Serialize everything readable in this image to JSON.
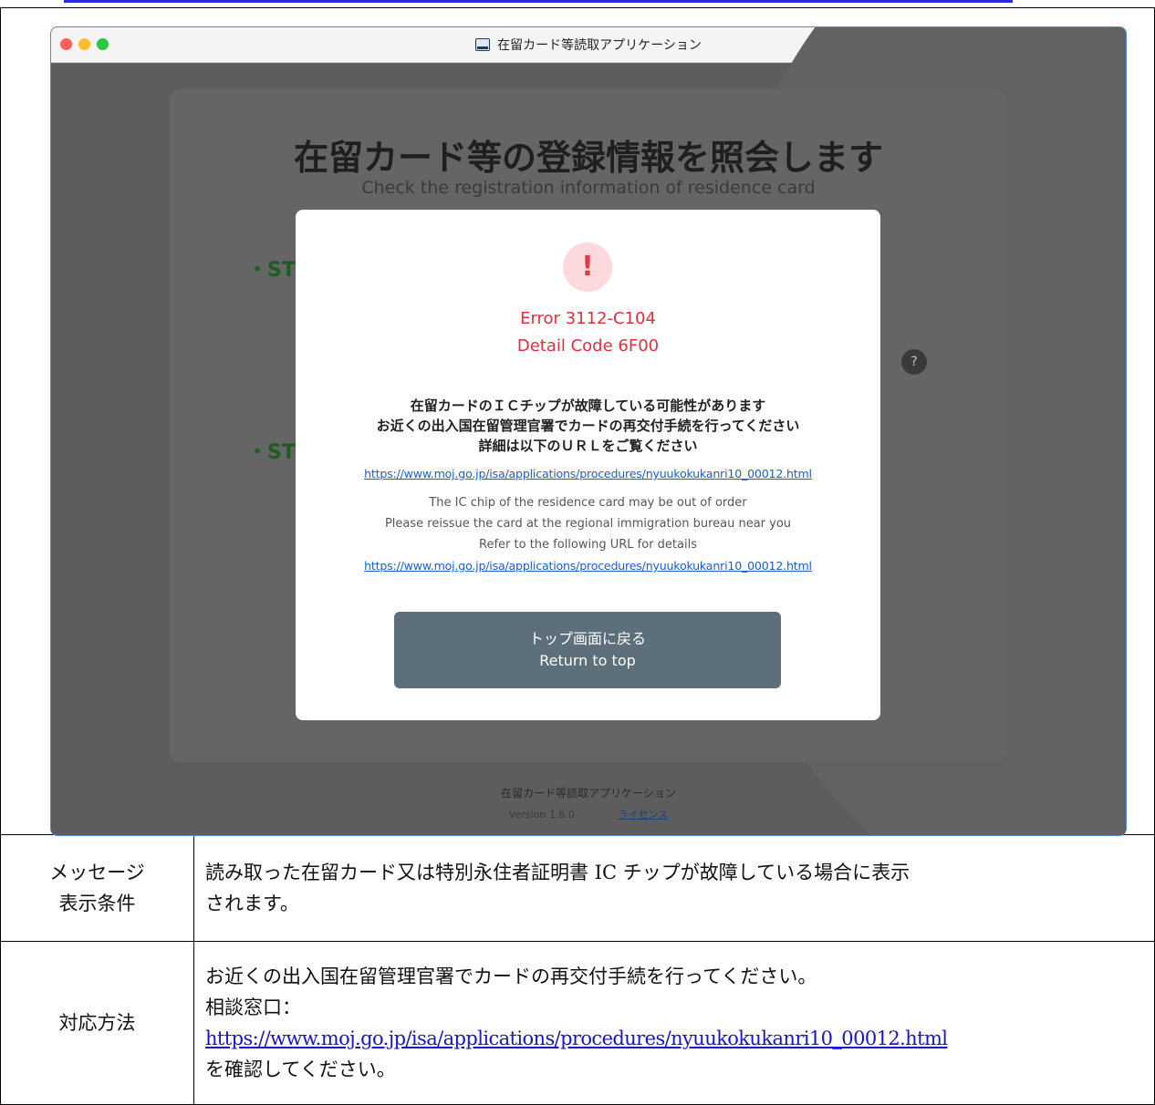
{
  "window": {
    "title": "在留カード等読取アプリケーション"
  },
  "background": {
    "heading": "在留カード等の登録情報を照会します",
    "subheading": "Check the registration information of residence card",
    "step1": "・ST",
    "step2": "・ST",
    "help": "?"
  },
  "modal": {
    "icon": "!",
    "error_code": "Error 3112-C104",
    "detail_code": "Detail Code 6F00",
    "jp_lines": [
      "在留カードのＩＣチップが故障している可能性があります",
      "お近くの出入国在留管理官署でカードの再交付手続を行ってください",
      "詳細は以下のＵＲＬをご覧ください"
    ],
    "url": "https://www.moj.go.jp/isa/applications/procedures/nyuukokukanri10_00012.html",
    "en_lines": [
      "The IC chip of the residence card may be out of order",
      "Please reissue the card at the regional immigration bureau near you",
      "Refer to the following URL for details"
    ],
    "button_jp": "トップ画面に戻る",
    "button_en": "Return to top"
  },
  "footer": {
    "app_name": "在留カード等読取アプリケーション",
    "version": "Version 1.6.0",
    "license": "ライセンス"
  },
  "table": {
    "row_condition": {
      "label_lines": [
        "メッセージ",
        "表示条件"
      ],
      "text_lines": [
        "読み取った在留カード又は特別永住者証明書 IC チップが故障している場合に表示",
        "されます。"
      ]
    },
    "row_action": {
      "label": "対応方法",
      "line1": "お近くの出入国在留管理官署でカードの再交付手続を行ってください。",
      "line2": "相談窓口：",
      "link": "https://www.moj.go.jp/isa/applications/procedures/nyuukokukanri10_00012.html",
      "line4": "を確認してください。"
    }
  }
}
